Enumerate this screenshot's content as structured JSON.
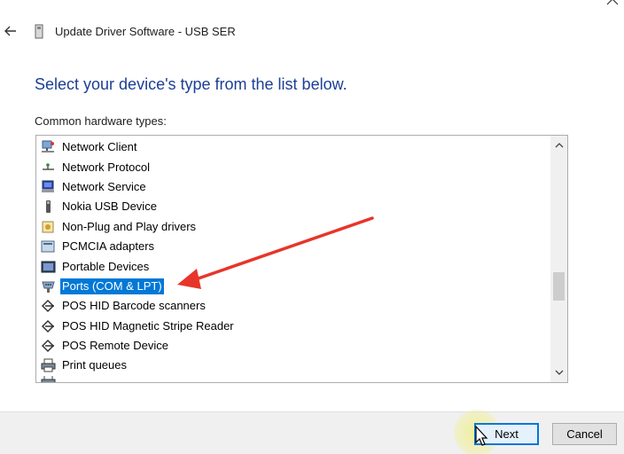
{
  "window": {
    "title": "Update Driver Software - USB SER",
    "close_icon": "close-icon",
    "back_icon": "back-arrow-icon"
  },
  "main": {
    "heading": "Select your device's type from the list below.",
    "list_label": "Common hardware types:",
    "items": [
      {
        "label": "Network Client",
        "icon": "network-client-icon"
      },
      {
        "label": "Network Protocol",
        "icon": "network-protocol-icon"
      },
      {
        "label": "Network Service",
        "icon": "network-service-icon"
      },
      {
        "label": "Nokia USB Device",
        "icon": "usb-device-icon"
      },
      {
        "label": "Non-Plug and Play drivers",
        "icon": "non-pnp-icon"
      },
      {
        "label": "PCMCIA adapters",
        "icon": "pcmcia-icon"
      },
      {
        "label": "Portable Devices",
        "icon": "portable-device-icon"
      },
      {
        "label": "Ports (COM & LPT)",
        "icon": "port-icon",
        "selected": true
      },
      {
        "label": "POS HID Barcode scanners",
        "icon": "pos-icon"
      },
      {
        "label": "POS HID Magnetic Stripe Reader",
        "icon": "pos-icon"
      },
      {
        "label": "POS Remote Device",
        "icon": "pos-icon"
      },
      {
        "label": "Print queues",
        "icon": "printer-icon"
      }
    ]
  },
  "footer": {
    "next_label": "Next",
    "cancel_label": "Cancel"
  },
  "colors": {
    "heading": "#1c3f94",
    "selection": "#0078d7",
    "annotation_arrow": "#e8352a"
  }
}
